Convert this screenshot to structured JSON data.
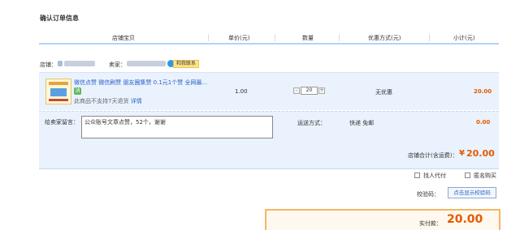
{
  "section_title": "确认订单信息",
  "columns": [
    "店铺宝贝",
    "单价(元)",
    "数量",
    "优惠方式(元)",
    "小计(元)"
  ],
  "shop": {
    "shop_label": "店铺：",
    "seller_label": "卖家：",
    "contact_label": "和我联系"
  },
  "item": {
    "title": "微信点赞 微信刷赞 朋友圈集赞 0.1元1个赞 全网最...",
    "return_note": "此商品不支持7天退货",
    "details_link": "详情",
    "price": "1.00",
    "qty_minus": "-",
    "quantity": "20",
    "qty_plus": "+",
    "discount": "无优惠",
    "subtotal": "20.00"
  },
  "message": {
    "label": "给卖家留言：",
    "value": "公众账号文章点赞，52个，谢谢"
  },
  "shipping": {
    "label": "运送方式：",
    "method": "快递 免邮",
    "fee": "0.00"
  },
  "shop_total": {
    "label": "店铺合计(含运费)：",
    "currency": "¥",
    "amount": "20.00"
  },
  "options": {
    "pay_for_me": "找人代付",
    "anonymous": "匿名购买"
  },
  "captcha": {
    "label": "校验码：",
    "button": "点击显示校验码"
  },
  "pay": {
    "label": "实付款：",
    "amount": "20.00"
  },
  "colors": {
    "accent_orange": "#e35a00",
    "link_blue": "#2a62c8",
    "row_bg": "#eaf2fd",
    "header_line": "#b2d1ff"
  }
}
